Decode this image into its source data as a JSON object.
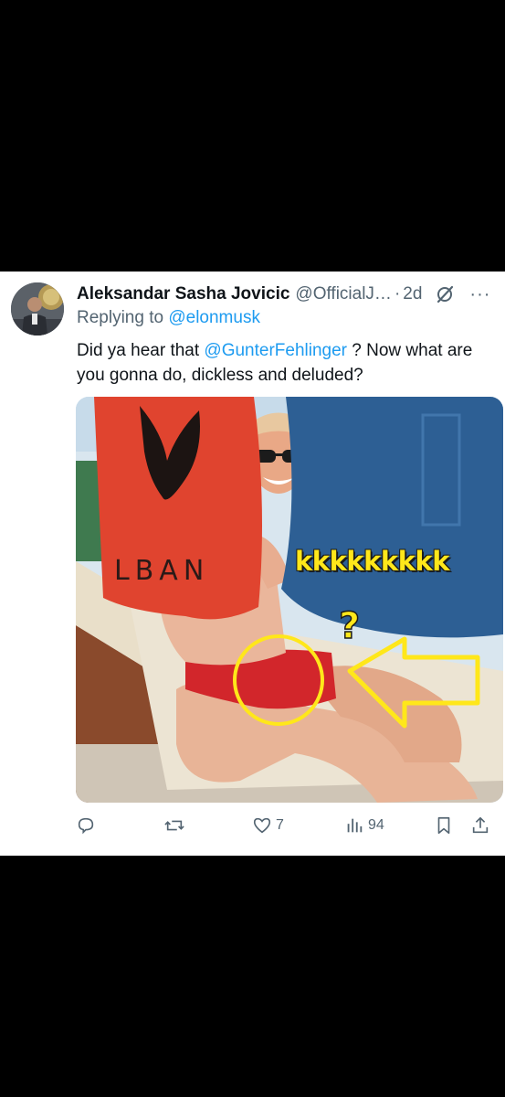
{
  "tweet": {
    "author_name": "Aleksandar Sasha Jovicic",
    "handle": "@OfficialJ…",
    "separator": "·",
    "time": "2d",
    "reply_prefix": "Replying to",
    "reply_to": "@elonmusk",
    "text_part1": "Did ya hear that ",
    "text_mention": "@GunterFehlinger",
    "text_part2": " ? Now what are you gonna do, dickless and deluded?",
    "more_label": "···"
  },
  "media": {
    "overlay_text": "kkkkkkkkk",
    "flag_text": "LBAN"
  },
  "actions": {
    "reply_icon": "reply-icon",
    "retweet_icon": "retweet-icon",
    "like_icon": "heart-icon",
    "like_count": "7",
    "views_icon": "views-icon",
    "views_count": "94",
    "bookmark_icon": "bookmark-icon",
    "share_icon": "share-icon"
  },
  "colors": {
    "link": "#1d9bf0",
    "secondary": "#536471",
    "primary_text": "#0f1419",
    "overlay_yellow": "#ffe71a"
  }
}
